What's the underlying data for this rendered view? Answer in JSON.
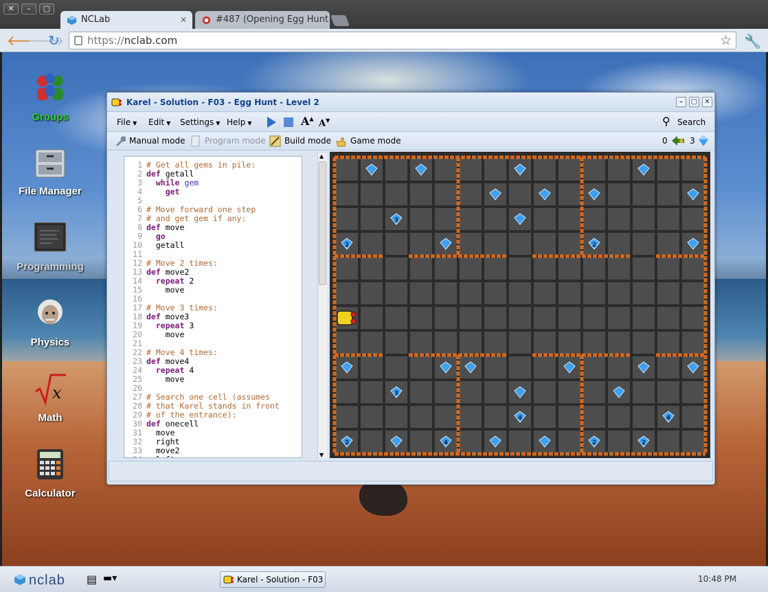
{
  "browser": {
    "tabs": [
      {
        "label": "NCLab",
        "active": true
      },
      {
        "label": "#487 (Opening Egg Hunt (",
        "active": false
      }
    ],
    "url_scheme": "https://",
    "url_host": "nclab.com",
    "window_controls": [
      "close-icon",
      "minimize-icon",
      "maximize-icon"
    ]
  },
  "desktop": {
    "icons": [
      {
        "label": "Groups",
        "icon": "groups-icon",
        "color": "#33cc33"
      },
      {
        "label": "File Manager",
        "icon": "file-cabinet-icon"
      },
      {
        "label": "Programming",
        "icon": "monitor-icon"
      },
      {
        "label": "Physics",
        "icon": "einstein-icon"
      },
      {
        "label": "Math",
        "icon": "sqrt-x-icon"
      },
      {
        "label": "Calculator",
        "icon": "calculator-icon"
      }
    ]
  },
  "karel_window": {
    "title": "Karel - Solution - F03 - Egg Hunt - Level 2",
    "menus": [
      "File",
      "Edit",
      "Settings",
      "Help"
    ],
    "search_label": "Search",
    "modes": [
      {
        "label": "Manual mode",
        "icon": "wrench-icon",
        "enabled": true
      },
      {
        "label": "Program mode",
        "icon": "document-icon",
        "enabled": false
      },
      {
        "label": "Build mode",
        "icon": "build-icon",
        "enabled": true
      },
      {
        "label": "Game mode",
        "icon": "hand-icon",
        "enabled": true
      }
    ],
    "counter_left": "0",
    "counter_right": "3",
    "code_lines": [
      {
        "n": "1",
        "parts": [
          [
            "com",
            "# Get all gems in pile:"
          ]
        ]
      },
      {
        "n": "2",
        "parts": [
          [
            "kw",
            "def"
          ],
          [
            "fn",
            " getall"
          ]
        ]
      },
      {
        "n": "3",
        "parts": [
          [
            "fn",
            "  "
          ],
          [
            "kw",
            "while"
          ],
          [
            "bl",
            " gem"
          ]
        ]
      },
      {
        "n": "4",
        "parts": [
          [
            "fn",
            "    "
          ],
          [
            "kw",
            "get"
          ]
        ]
      },
      {
        "n": "5",
        "parts": []
      },
      {
        "n": "6",
        "parts": [
          [
            "com",
            "# Move forward one step"
          ]
        ]
      },
      {
        "n": "7",
        "parts": [
          [
            "com",
            "# and get gem if any:"
          ]
        ]
      },
      {
        "n": "8",
        "parts": [
          [
            "kw",
            "def"
          ],
          [
            "fn",
            " move"
          ]
        ]
      },
      {
        "n": "9",
        "parts": [
          [
            "fn",
            "  "
          ],
          [
            "kw",
            "go"
          ]
        ]
      },
      {
        "n": "10",
        "parts": [
          [
            "fn",
            "  getall"
          ]
        ]
      },
      {
        "n": "11",
        "parts": []
      },
      {
        "n": "12",
        "parts": [
          [
            "com",
            "# Move 2 times:"
          ]
        ]
      },
      {
        "n": "13",
        "parts": [
          [
            "kw",
            "def"
          ],
          [
            "fn",
            " move2"
          ]
        ]
      },
      {
        "n": "14",
        "parts": [
          [
            "fn",
            "  "
          ],
          [
            "kw",
            "repeat"
          ],
          [
            "fn",
            " 2"
          ]
        ]
      },
      {
        "n": "15",
        "parts": [
          [
            "fn",
            "    move"
          ]
        ]
      },
      {
        "n": "16",
        "parts": []
      },
      {
        "n": "17",
        "parts": [
          [
            "com",
            "# Move 3 times:"
          ]
        ]
      },
      {
        "n": "18",
        "parts": [
          [
            "kw",
            "def"
          ],
          [
            "fn",
            " move3"
          ]
        ]
      },
      {
        "n": "19",
        "parts": [
          [
            "fn",
            "  "
          ],
          [
            "kw",
            "repeat"
          ],
          [
            "fn",
            " 3"
          ]
        ]
      },
      {
        "n": "20",
        "parts": [
          [
            "fn",
            "    move"
          ]
        ]
      },
      {
        "n": "21",
        "parts": []
      },
      {
        "n": "22",
        "parts": [
          [
            "com",
            "# Move 4 times:"
          ]
        ]
      },
      {
        "n": "23",
        "parts": [
          [
            "kw",
            "def"
          ],
          [
            "fn",
            " move4"
          ]
        ]
      },
      {
        "n": "24",
        "parts": [
          [
            "fn",
            "  "
          ],
          [
            "kw",
            "repeat"
          ],
          [
            "fn",
            " 4"
          ]
        ]
      },
      {
        "n": "25",
        "parts": [
          [
            "fn",
            "    move"
          ]
        ]
      },
      {
        "n": "26",
        "parts": []
      },
      {
        "n": "27",
        "parts": [
          [
            "com",
            "# Search one cell (assumes"
          ]
        ]
      },
      {
        "n": "28",
        "parts": [
          [
            "com",
            "# that Karel stands in front"
          ]
        ]
      },
      {
        "n": "29",
        "parts": [
          [
            "com",
            "# of the entrance):"
          ]
        ]
      },
      {
        "n": "30",
        "parts": [
          [
            "kw",
            "def"
          ],
          [
            "fn",
            " onecell"
          ]
        ]
      },
      {
        "n": "31",
        "parts": [
          [
            "fn",
            "  move"
          ]
        ]
      },
      {
        "n": "32",
        "parts": [
          [
            "fn",
            "  right"
          ]
        ]
      },
      {
        "n": "33",
        "parts": [
          [
            "fn",
            "  move2"
          ]
        ]
      },
      {
        "n": "34",
        "parts": [
          [
            "fn",
            "  left"
          ]
        ]
      }
    ],
    "board": {
      "cols": 15,
      "rows": 12,
      "gems": [
        {
          "c": 1,
          "r": 0,
          "n": ""
        },
        {
          "c": 3,
          "r": 0,
          "n": ""
        },
        {
          "c": 7,
          "r": 0,
          "n": ""
        },
        {
          "c": 12,
          "r": 0,
          "n": ""
        },
        {
          "c": 6,
          "r": 1,
          "n": ""
        },
        {
          "c": 8,
          "r": 1,
          "n": ""
        },
        {
          "c": 10,
          "r": 1,
          "n": ""
        },
        {
          "c": 14,
          "r": 1,
          "n": ""
        },
        {
          "c": 2,
          "r": 2,
          "n": "3"
        },
        {
          "c": 7,
          "r": 2,
          "n": ""
        },
        {
          "c": 0,
          "r": 3,
          "n": "2"
        },
        {
          "c": 4,
          "r": 3,
          "n": ""
        },
        {
          "c": 10,
          "r": 3,
          "n": "2"
        },
        {
          "c": 14,
          "r": 3,
          "n": ""
        },
        {
          "c": 0,
          "r": 8,
          "n": ""
        },
        {
          "c": 4,
          "r": 8,
          "n": ""
        },
        {
          "c": 5,
          "r": 8,
          "n": ""
        },
        {
          "c": 9,
          "r": 8,
          "n": ""
        },
        {
          "c": 12,
          "r": 8,
          "n": ""
        },
        {
          "c": 14,
          "r": 8,
          "n": ""
        },
        {
          "c": 2,
          "r": 9,
          "n": "3"
        },
        {
          "c": 7,
          "r": 9,
          "n": ""
        },
        {
          "c": 11,
          "r": 9,
          "n": ""
        },
        {
          "c": 7,
          "r": 10,
          "n": "4"
        },
        {
          "c": 13,
          "r": 10,
          "n": "4"
        },
        {
          "c": 0,
          "r": 11,
          "n": "2"
        },
        {
          "c": 2,
          "r": 11,
          "n": ""
        },
        {
          "c": 4,
          "r": 11,
          "n": "4"
        },
        {
          "c": 6,
          "r": 11,
          "n": ""
        },
        {
          "c": 8,
          "r": 11,
          "n": ""
        },
        {
          "c": 10,
          "r": 11,
          "n": "2"
        },
        {
          "c": 12,
          "r": 11,
          "n": "2"
        }
      ],
      "robot": {
        "c": 0,
        "r": 6
      },
      "colors": {
        "cell": "#4d4d4d",
        "wall": "#d2691e",
        "gem": "#3ea0f0",
        "robot": "#f2d21b"
      }
    }
  },
  "taskbar": {
    "logo": "nclab",
    "task_label": "Karel - Solution - F03 -",
    "time": "10:48 PM"
  }
}
